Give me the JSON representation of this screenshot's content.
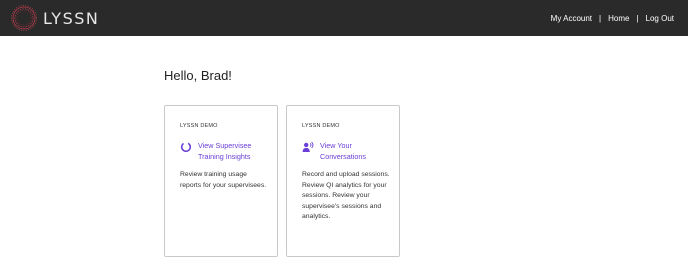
{
  "header": {
    "brand": "LYSSN",
    "nav": [
      {
        "label": "My Account"
      },
      {
        "label": "Home"
      },
      {
        "label": "Log Out"
      }
    ],
    "separator": "|"
  },
  "main": {
    "greeting": "Hello, Brad!",
    "cards": [
      {
        "tag": "LYSSN DEMO",
        "link_label": "View Supervisee Training Insights",
        "icon": "loading-ring-icon",
        "description": "Review training usage reports for your supervisees."
      },
      {
        "tag": "LYSSN DEMO",
        "link_label": "View Your Conversations",
        "icon": "speaking-person-icon",
        "description": "Record and upload sessions. Review QI analytics for your sessions. Review your supervisee's sessions and analytics."
      }
    ]
  },
  "colors": {
    "topbar": "#2a2a2a",
    "accent": "#6a3fd6",
    "logo": "#b83a4b"
  }
}
